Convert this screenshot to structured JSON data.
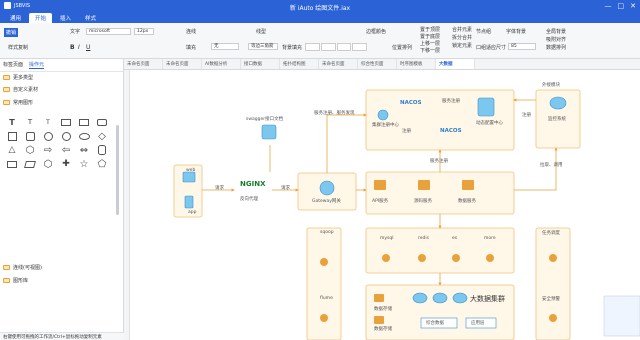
{
  "titlebar": {
    "app": "JSBVIS",
    "filename": "新 iAuto 绘图文件.iax",
    "controls": [
      "—",
      "□",
      "✕"
    ]
  },
  "menu": [
    "通用",
    "开始",
    "插入",
    "样式"
  ],
  "menu_active": 1,
  "ribbon": {
    "undo": "撤销",
    "format_painter": "样式复制",
    "text_label": "文字",
    "font": "microsoft",
    "font_size": "12px",
    "connector": "连线",
    "line_style": "线型",
    "line_color": "边框颜色",
    "fill": "填充",
    "fill_value": "无",
    "arrow": "箭头",
    "arrow_value": "等边三角箭",
    "bg": "背景填充",
    "position": "位置排列",
    "top": "置于顶层",
    "bottom": "置于底层",
    "up": "上移一层",
    "down": "下移一层",
    "merge": "合并元素",
    "split": "拆分合并",
    "lock": "锁定元素",
    "node": "节点组",
    "ungroup": "取消合并",
    "size": "尺寸",
    "size_value": "85",
    "font_bg": "字体背景",
    "size_opt": "口组适应尺寸",
    "grid": "全局背景",
    "snap": "吸附对齐",
    "align": "数据排列"
  },
  "sidebar": {
    "tabs": [
      "标签页面",
      "操作元"
    ],
    "more": "更多类型",
    "custom": "自定义素材",
    "common": "常用图形",
    "lib1": "连线(可视图)",
    "lib2": "图形库",
    "status": "右键使用可拖拽的工作流/Ctrl+鼠标拖动复制元素"
  },
  "canvas_tabs": [
    "未命名页面",
    "未命名页面",
    "AI数据分析",
    "接口数据",
    "拓扑结构图",
    "未命名页面",
    "综合性页面",
    "时序图模板",
    "大数据"
  ],
  "canvas_tab_active": 8,
  "diagram": {
    "web": "web",
    "app": "app",
    "request1": "请求",
    "request2": "请求",
    "nginx": "NGINX",
    "proxy": "反向代理",
    "swagger": "swagger接口文档",
    "gateway": "Gateway网关",
    "reg": "服务注册、服务发现",
    "nacos_left": "NACOS",
    "nacos_right": "NACOS",
    "cluster": "集群注册中心",
    "service_reg": "服务注册",
    "dynamic": "动态配置中心",
    "register": "注册",
    "register2": "注册",
    "service_reg2": "服务注册",
    "external": "外接模块",
    "monitor": "监控系统",
    "pull": "拉取、调用",
    "api": "API服务",
    "svc1": "源码服务",
    "svc2": "数据服务",
    "sqoop": "sqoop",
    "flume": "flume",
    "db": [
      "mysql",
      "redis",
      "es",
      "more"
    ],
    "bigdata": "大数据集群",
    "store1": "数据存储",
    "store2": "数据存储",
    "data_store": "数据存储",
    "comp1": "综合数据",
    "comp2": "应用层",
    "task": "任务调度",
    "alert": "安全预警"
  }
}
